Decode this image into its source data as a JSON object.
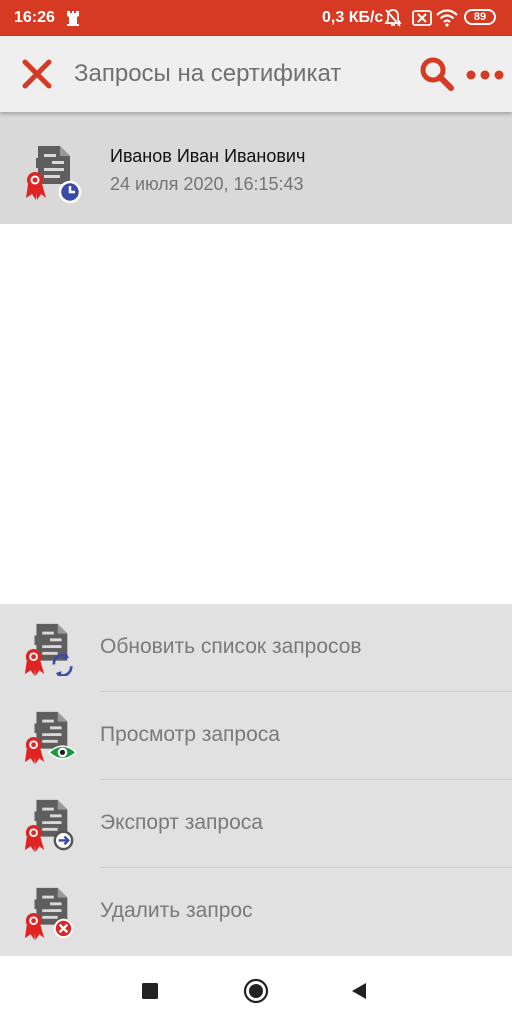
{
  "status_bar": {
    "time": "16:26",
    "network_speed": "0,3 КБ/с",
    "battery": "89",
    "icons": [
      "castle-icon",
      "bell-off-icon",
      "sim-off-icon",
      "wifi-icon",
      "battery-icon"
    ],
    "color": "#d63a22"
  },
  "toolbar": {
    "title": "Запросы на сертификат",
    "close_icon": "close-icon",
    "search_icon": "search-icon",
    "more_icon": "more-icon",
    "accent_color": "#d63a22"
  },
  "requests": [
    {
      "name": "Иванов Иван Иванович",
      "date": "24 июля 2020, 16:15:43",
      "icon": "certificate-clock-icon"
    }
  ],
  "actions": [
    {
      "label": "Обновить список запросов",
      "icon": "certificate-refresh-icon"
    },
    {
      "label": "Просмотр запроса",
      "icon": "certificate-view-icon"
    },
    {
      "label": "Экспорт запроса",
      "icon": "certificate-export-icon"
    },
    {
      "label": "Удалить запрос",
      "icon": "certificate-delete-icon"
    }
  ],
  "nav_bar": {
    "icons": [
      "recents-icon",
      "home-icon",
      "back-icon"
    ]
  }
}
